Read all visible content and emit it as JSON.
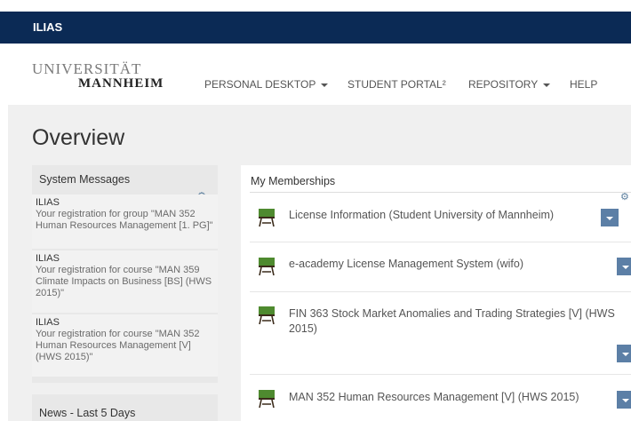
{
  "header": {
    "brand": "ILIAS"
  },
  "logo": {
    "line1": "UNIVERSITÄT",
    "line2": "MANNHEIM"
  },
  "nav": [
    {
      "label": "PERSONAL DESKTOP",
      "has_caret": true
    },
    {
      "label": "STUDENT PORTAL²",
      "has_caret": false
    },
    {
      "label": "REPOSITORY",
      "has_caret": true
    },
    {
      "label": "HELP",
      "has_caret": false
    }
  ],
  "page": {
    "title": "Overview"
  },
  "system_messages": {
    "title": "System Messages",
    "items": [
      {
        "from": "ILIAS",
        "text": "Your registration for group \"MAN 352 Human Resources Management [1. PG]\""
      },
      {
        "from": "ILIAS",
        "text": "Your registration for course \"MAN 359 Climate Impacts on Business [BS] (HWS 2015)\""
      },
      {
        "from": "ILIAS",
        "text": "Your registration for course \"MAN 352 Human Resources Management [V] (HWS 2015)\""
      }
    ]
  },
  "news": {
    "title": "News - Last 5 Days"
  },
  "memberships": {
    "title": "My Memberships",
    "items": [
      {
        "title": "License Information (Student University of Mannheim)"
      },
      {
        "title": "e-academy License Management System (wifo)"
      },
      {
        "title": "FIN 363 Stock Market Anomalies and Trading Strategies [V] (HWS 2015)"
      },
      {
        "title": "MAN 352 Human Resources Management [V] (HWS 2015)"
      }
    ]
  },
  "colors": {
    "brand_bar": "#0b2a55",
    "content_bg": "#f0f0f0",
    "dropdown": "#5c7fa6",
    "course_icon": "#4e8a2f"
  }
}
